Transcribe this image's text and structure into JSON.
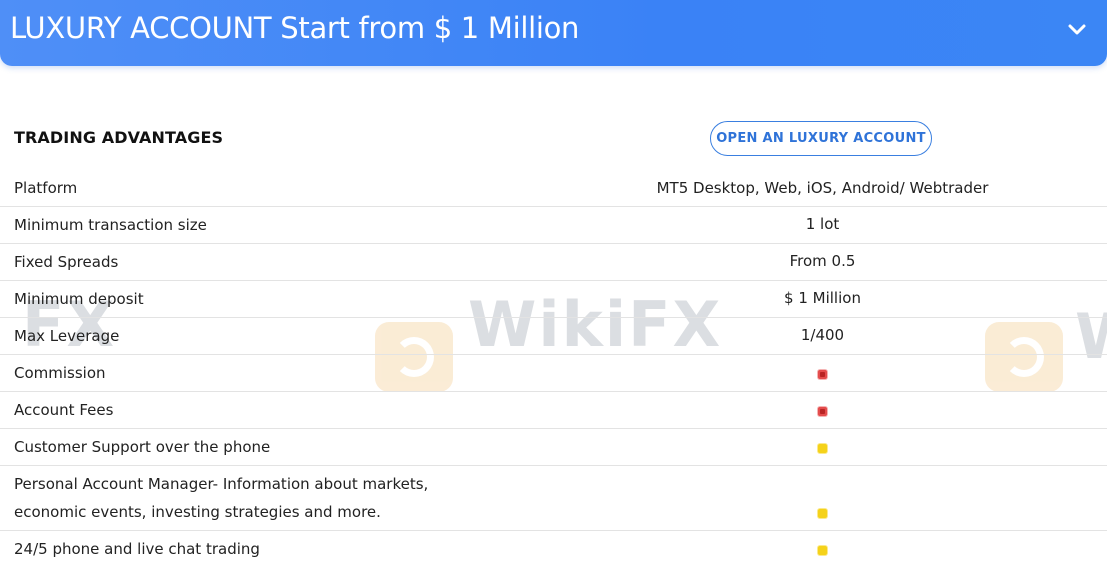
{
  "header": {
    "title": "LUXURY ACCOUNT Start from $ 1 Million",
    "accent_color": "#3a82f6",
    "toggle_icon": "chevron-down-icon"
  },
  "section": {
    "title": "TRADING ADVANTAGES",
    "open_button_label": "OPEN AN LUXURY ACCOUNT"
  },
  "watermark": {
    "text": "WikiFX",
    "fragment_left": "FX",
    "fragment_right": "W"
  },
  "rows": [
    {
      "label": "Platform",
      "value": "MT5 Desktop, Web, iOS, Android/ Webtrader"
    },
    {
      "label": "Minimum transaction size",
      "value": "1 lot"
    },
    {
      "label": "Fixed Spreads",
      "value": "From 0.5"
    },
    {
      "label": "Minimum deposit",
      "value": "$ 1 Million"
    },
    {
      "label": "Max Leverage",
      "value": "1/400"
    },
    {
      "label": "Commission",
      "status": "no",
      "status_color": "#e44c4c"
    },
    {
      "label": "Account Fees",
      "status": "no",
      "status_color": "#e44c4c"
    },
    {
      "label": "Customer Support over the phone",
      "status": "yes",
      "status_color": "#f5d21a"
    },
    {
      "label_line1": "Personal Account Manager- Information about markets,",
      "label_line2": "economic events, investing strategies and more.",
      "status": "yes",
      "status_color": "#f5d21a"
    },
    {
      "label": "24/5 phone and live chat trading",
      "status": "yes",
      "status_color": "#f5d21a"
    }
  ]
}
